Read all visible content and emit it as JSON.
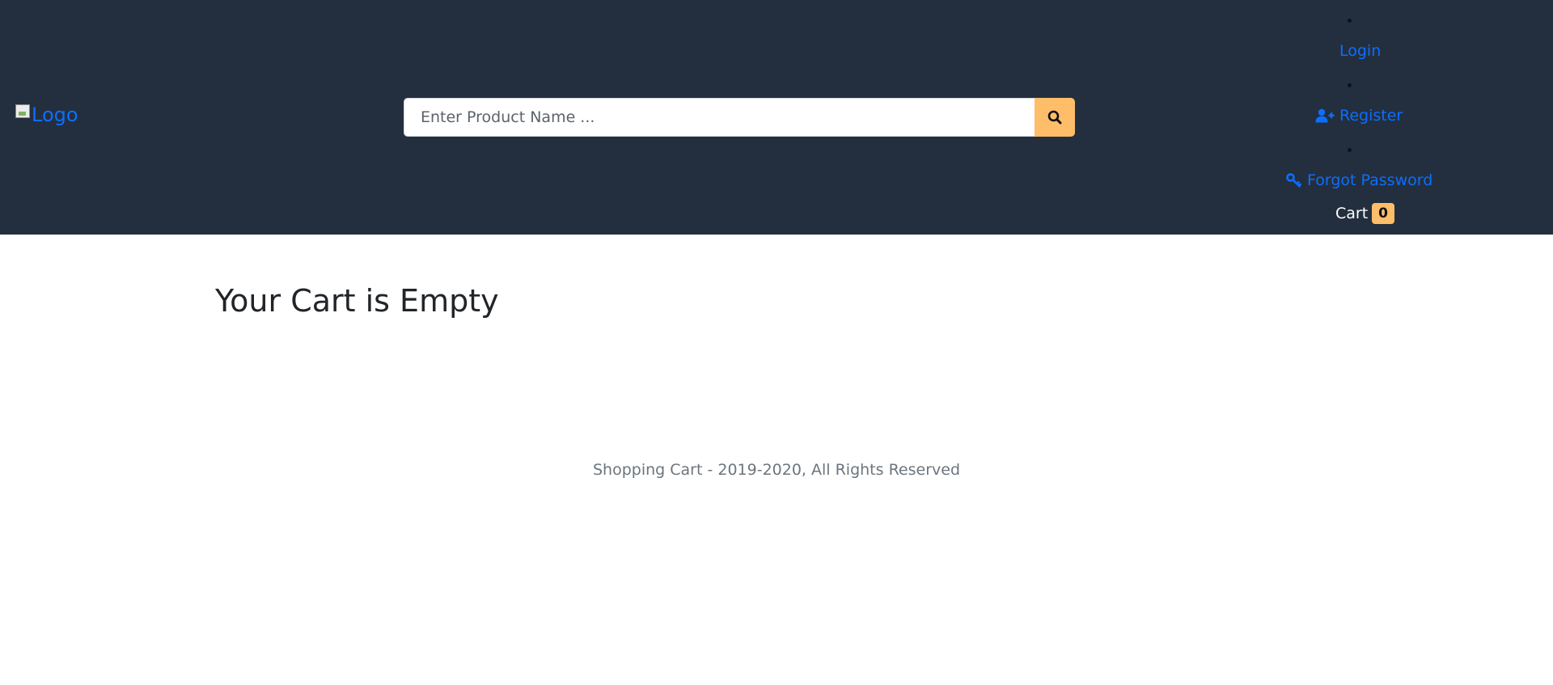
{
  "header": {
    "logo_alt": "Logo",
    "search": {
      "placeholder": "Enter Product Name ...",
      "value": ""
    },
    "search_icon": "search-icon",
    "nav": {
      "login": "Login",
      "register": "Register",
      "register_icon": "user-plus-icon",
      "forgot_password": "Forgot Password",
      "forgot_icon": "key-icon"
    },
    "cart": {
      "label": "Cart",
      "count": "0"
    }
  },
  "main": {
    "heading": "Your Cart is Empty"
  },
  "footer": {
    "text": "Shopping Cart - 2019-2020, All Rights Reserved"
  },
  "colors": {
    "header_bg": "#232f3e",
    "accent": "#febd69",
    "link": "#0d6efd"
  }
}
